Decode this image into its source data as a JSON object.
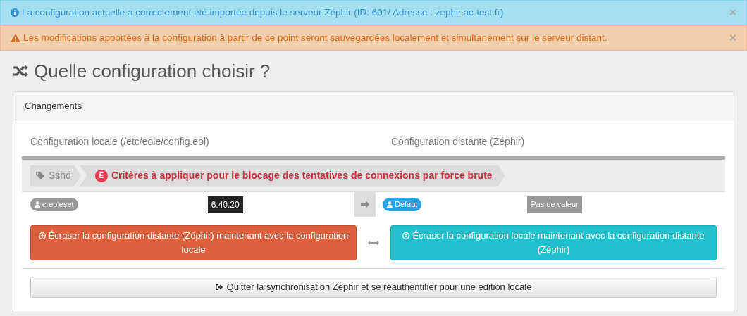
{
  "alerts": [
    {
      "kind": "info",
      "text": "La configuration actuelle a correctement été importée depuis le serveur Zéphir (ID: 601/ Adresse : zephir.ac-test.fr)",
      "close": "×"
    },
    {
      "kind": "warning",
      "text": "Les modifications apportées à la configuration à partir de ce point seront sauvegardées localement et simultanément sur le serveur distant.",
      "close": "×"
    }
  ],
  "title": "Quelle configuration choisir ?",
  "panel": {
    "heading": "Changements",
    "columns": [
      "Configuration locale (/etc/eole/config.eol)",
      "Configuration distante (Zéphir)"
    ],
    "breadcrumb": {
      "family": "Sshd",
      "badge": "E",
      "variable": "Critères à appliquer pour le blocage des tentatives de connexions par force brute"
    },
    "local": {
      "user": "creoleset",
      "value": "6:40:20"
    },
    "remote": {
      "user": "Defaut",
      "value": "Pas de valeur"
    },
    "buttons": [
      {
        "kind": "push",
        "label": "Écraser la configuration distante (Zéphir) maintenant avec la configuration locale"
      },
      {
        "kind": "pull",
        "label": "Écraser la configuration locale maintenant avec la configuration distante (Zéphir)"
      }
    ],
    "quit": "Quitter la synchronisation Zéphir et se réauthentifier pour une édition locale"
  }
}
